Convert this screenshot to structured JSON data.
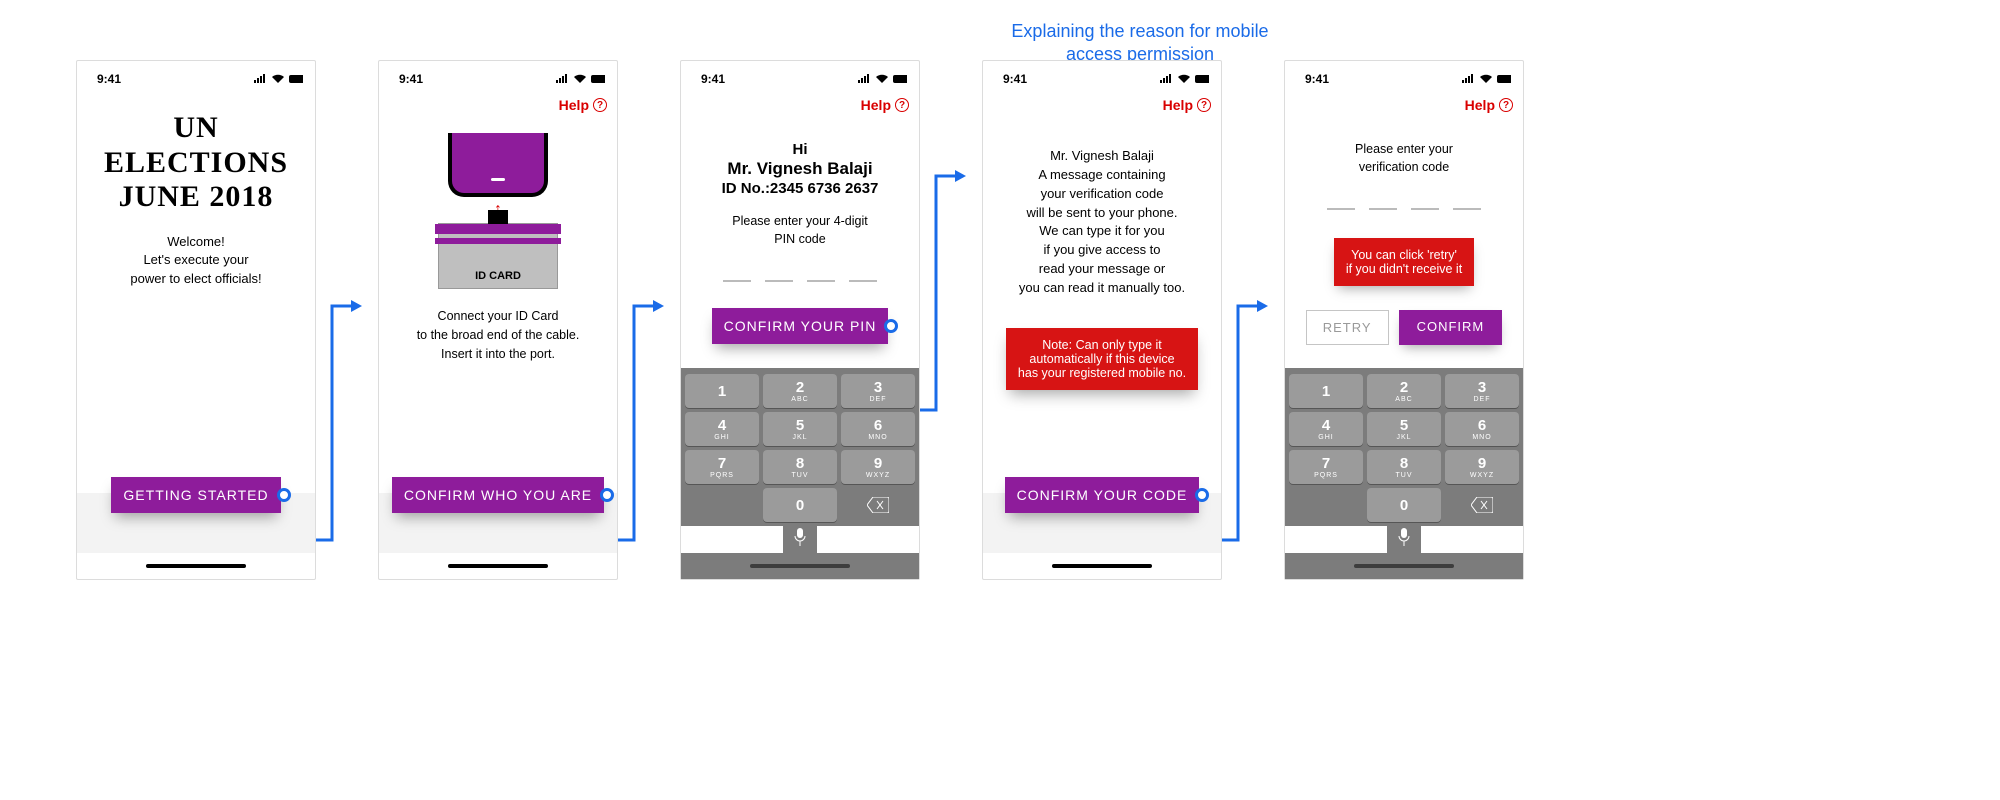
{
  "annotation": "Explaining the reason for mobile access permission",
  "status": {
    "time": "9:41"
  },
  "help_label": "Help",
  "screen1": {
    "title_l1": "UN",
    "title_l2": "ELECTIONS",
    "title_l3": "JUNE 2018",
    "welcome_l1": "Welcome!",
    "welcome_l2": "Let's execute your",
    "welcome_l3": "power to elect officials!",
    "cta": "GETTING STARTED"
  },
  "screen2": {
    "card_label": "ID CARD",
    "instr_l1": "Connect your ID Card",
    "instr_l2": "to the broad end of the cable.",
    "instr_l3": "Insert it into the port.",
    "cta": "CONFIRM WHO YOU ARE"
  },
  "screen3": {
    "hi": "Hi",
    "name": "Mr. Vignesh Balaji",
    "id": "ID No.:2345 6736 2637",
    "prompt_l1": "Please enter your 4-digit",
    "prompt_l2": "PIN code",
    "cta": "CONFIRM YOUR PIN"
  },
  "screen4": {
    "l1": "Mr. Vignesh Balaji",
    "l2": "A message containing",
    "l3": "your verification code",
    "l4": "will be sent to your phone.",
    "l5": "We can type it for you",
    "l6": "if you give access to",
    "l7": "read your message or",
    "l8": "you can read it manually too.",
    "note_l1": "Note: Can only type it",
    "note_l2": "automatically if this device",
    "note_l3": "has your registered mobile no.",
    "cta": "CONFIRM YOUR CODE"
  },
  "screen5": {
    "prompt_l1": "Please enter your",
    "prompt_l2": "verification code",
    "tip_l1": "You can click 'retry'",
    "tip_l2": "if you didn't receive it",
    "retry": "RETRY",
    "confirm": "CONFIRM"
  },
  "keypad": {
    "r1": [
      {
        "n": "1",
        "l": ""
      },
      {
        "n": "2",
        "l": "ABC"
      },
      {
        "n": "3",
        "l": "DEF"
      }
    ],
    "r2": [
      {
        "n": "4",
        "l": "GHI"
      },
      {
        "n": "5",
        "l": "JKL"
      },
      {
        "n": "6",
        "l": "MNO"
      }
    ],
    "r3": [
      {
        "n": "7",
        "l": "PQRS"
      },
      {
        "n": "8",
        "l": "TUV"
      },
      {
        "n": "9",
        "l": "WXYZ"
      }
    ],
    "zero": {
      "n": "0",
      "l": ""
    }
  }
}
